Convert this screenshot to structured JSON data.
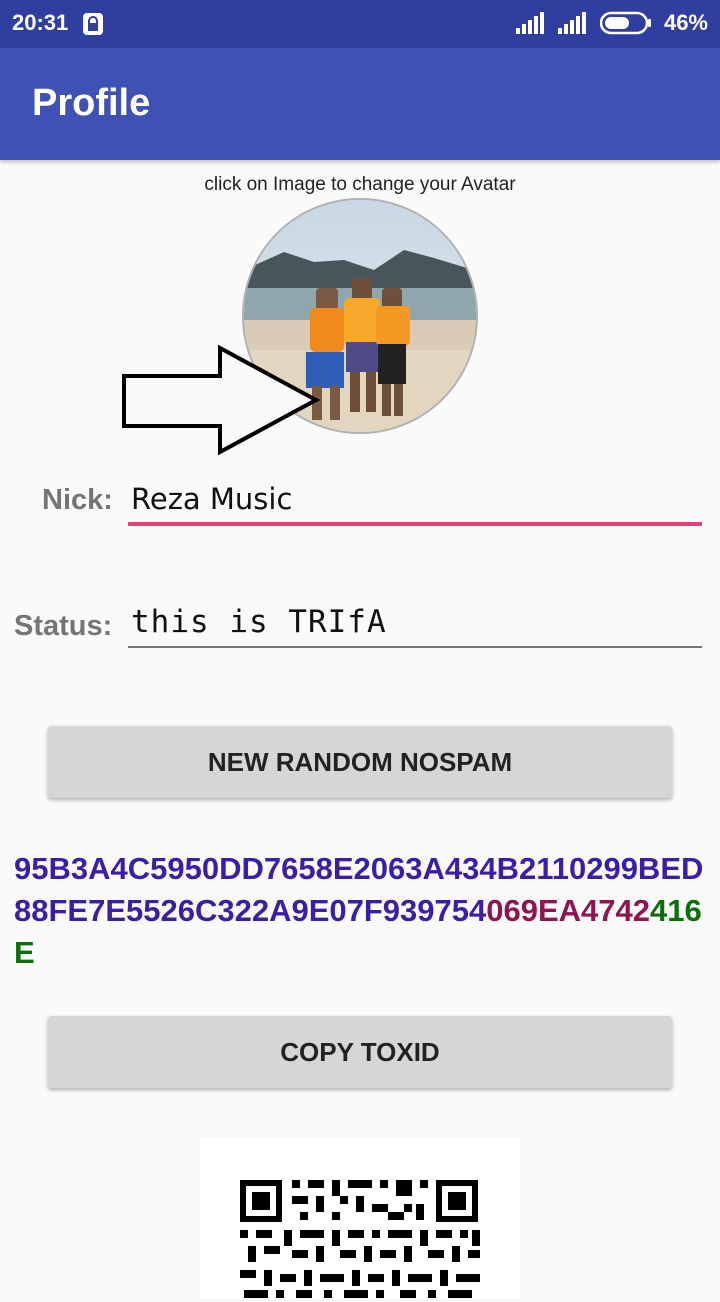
{
  "status_bar": {
    "time": "20:31",
    "battery_percent": "46%",
    "icons": [
      "lock-icon",
      "signal-icon",
      "signal-icon",
      "battery-icon"
    ]
  },
  "app_bar": {
    "title": "Profile"
  },
  "avatar": {
    "hint": "click on Image to change your Avatar"
  },
  "nick": {
    "label": "Nick:",
    "value": "Reza Music"
  },
  "status": {
    "label": "Status:",
    "value": "this is TRIfA"
  },
  "buttons": {
    "new_nospam": "NEW RANDOM NOSPAM",
    "copy_toxid": "COPY TOXID"
  },
  "toxid": {
    "public_key": "95B3A4C5950DD7658E2063A434B2110299BED88FE7E5526C322A9E07F939754",
    "nospam": "069EA4742",
    "checksum": "416E"
  },
  "colors": {
    "status_bar": "#303f9f",
    "app_bar": "#3f51b5",
    "accent": "#e5407a",
    "toxid_public_key": "#3a1fa6",
    "toxid_nospam": "#8f1450",
    "toxid_checksum": "#0a6e0a"
  }
}
